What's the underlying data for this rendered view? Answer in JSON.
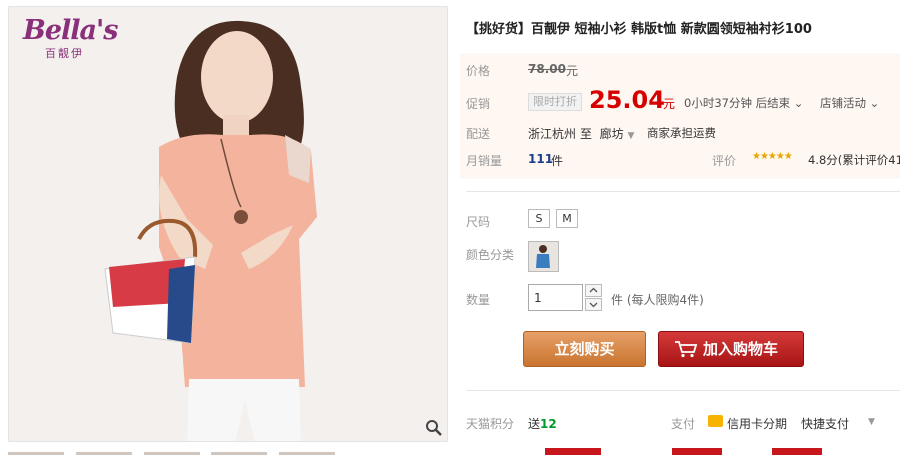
{
  "brand": {
    "logo_script": "Bella's",
    "logo_cn": "百靓伊"
  },
  "product": {
    "title": "【挑好货】百靓伊 短袖小衫 韩版t恤 新款圆领短袖衬衫100"
  },
  "price": {
    "label": "价格",
    "original": "78.00",
    "unit": "元"
  },
  "promotion": {
    "label": "促销",
    "tag": "限时打折",
    "price": "25.04",
    "unit": "元",
    "countdown": "0小时37分钟 后结束",
    "store_promo": "店铺活动"
  },
  "shipping": {
    "label": "配送",
    "from": "浙江杭州",
    "to_prefix": "至",
    "to": "廊坊",
    "fee": "商家承担运费"
  },
  "sales": {
    "label": "月销量",
    "count": "111",
    "unit": "件"
  },
  "rating": {
    "label": "评价",
    "stars": "★★★★★",
    "stars_value": 4.8,
    "text": "4.8分(累计评价41"
  },
  "size": {
    "label": "尺码",
    "options": [
      "S",
      "M"
    ]
  },
  "color": {
    "label": "颜色分类"
  },
  "quantity": {
    "label": "数量",
    "value": "1",
    "note": "件 (每人限购4件)"
  },
  "actions": {
    "buy_now": "立刻购买",
    "add_cart": "加入购物车"
  },
  "points": {
    "label": "天猫积分",
    "prefix": "送",
    "value": "12"
  },
  "payment": {
    "label": "支付",
    "credit": "信用卡分期",
    "quick": "快捷支付"
  },
  "colors": {
    "price_red": "#d60000",
    "buy_now_orange": "#c9742f",
    "add_cart_red": "#a81414",
    "sales_blue": "#1a3f8c",
    "points_green": "#009b2a"
  }
}
